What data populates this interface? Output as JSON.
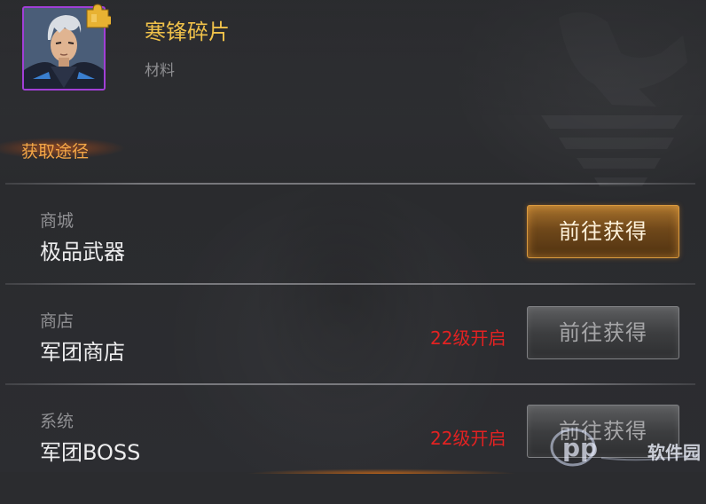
{
  "item": {
    "name": "寒锋碎片",
    "type": "材料",
    "avatar_icon": "character-portrait-icon",
    "fragment_icon": "puzzle-piece-icon",
    "frame_color": "#a13fd6"
  },
  "section": {
    "title": "获取途径"
  },
  "sources": [
    {
      "category": "商城",
      "name": "极品武器",
      "lock_text": "",
      "button_label": "前往获得",
      "enabled": true
    },
    {
      "category": "商店",
      "name": "军团商店",
      "lock_text": "22级开启",
      "button_label": "前往获得",
      "enabled": false
    },
    {
      "category": "系统",
      "name": "军团BOSS",
      "lock_text": "22级开启",
      "button_label": "前往获得",
      "enabled": false
    }
  ],
  "colors": {
    "item_name": "#f0c24a",
    "section_title": "#f3a646",
    "lock_text": "#e32222",
    "button_active_border": "#d99a3f"
  },
  "watermark": {
    "text": "软件园",
    "logo_icon": "pp-logo-icon"
  }
}
